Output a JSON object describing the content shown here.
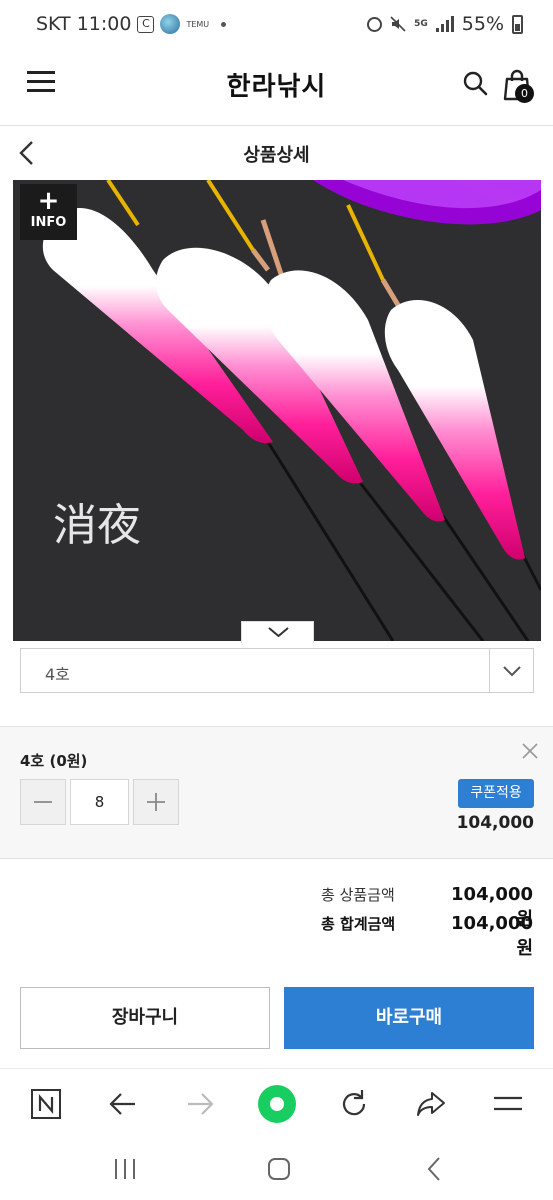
{
  "status_bar": {
    "carrier_time": "SKT 11:00",
    "box_icon_label": "C",
    "temu_label": "TEMU",
    "network": "5G",
    "battery": "55%"
  },
  "header": {
    "logo": "한라낚시",
    "cart_count": "0"
  },
  "subheader": {
    "title": "상품상세"
  },
  "product_image": {
    "info_plus": "+",
    "info_label": "INFO",
    "caption": "消夜",
    "accent_color": "#ff1f9a"
  },
  "option_select": {
    "value": "4호"
  },
  "selected_item": {
    "name": "4호 (0원)",
    "quantity": "8",
    "coupon_label": "쿠폰적용",
    "price": "104,000"
  },
  "totals": {
    "product_total_label": "총 상품금액",
    "product_total_value": "104,000원",
    "grand_total_label": "총 합계금액",
    "grand_total_value": "104,000원"
  },
  "actions": {
    "cart_label": "장바구니",
    "buy_label": "바로구매",
    "buy_color": "#2d7fd3"
  },
  "browser_toolbar": {
    "icons": [
      "naver-n-icon",
      "back-arrow-icon",
      "forward-arrow-icon",
      "naver-green-dot-icon",
      "refresh-icon",
      "share-icon",
      "menu-icon"
    ]
  }
}
